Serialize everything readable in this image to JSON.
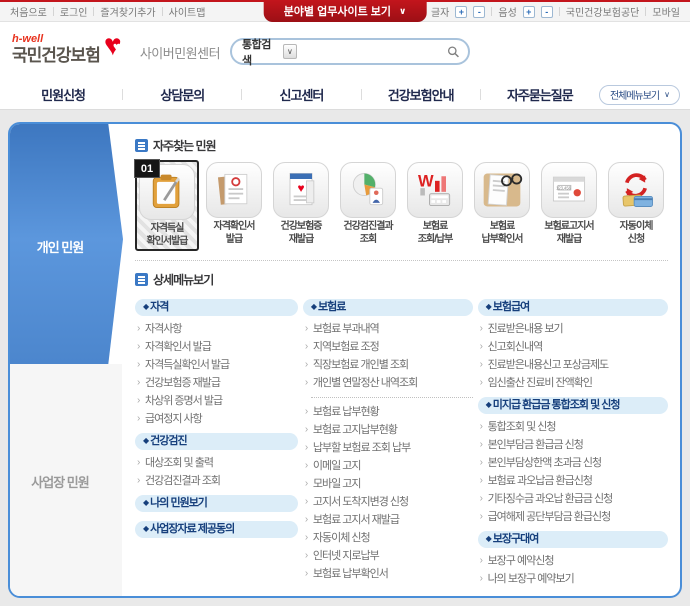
{
  "colors": {
    "brand_red": "#e8001c",
    "topbar_button_red": "#c3151c",
    "box_border_blue": "#4a8ed8",
    "sidebar_blue": "#4c86cd",
    "section_pill_bg": "#dcedf8",
    "section_text": "#163f7c"
  },
  "utility_bar": {
    "links_left": [
      "처음으로",
      "로그인",
      "즐겨찾기추가",
      "사이트맵"
    ],
    "center_button": "분야별 업무사이트 보기",
    "font_label": "글자",
    "voice_label": "음성",
    "plus": "+",
    "minus": "-",
    "links_right": [
      "국민건강보험공단",
      "모바일"
    ]
  },
  "header": {
    "logo_top": "h-well",
    "logo_main": "국민건강보험",
    "site_name": "사이버민원센터",
    "search": {
      "category": "통합검색",
      "value": "",
      "placeholder": ""
    }
  },
  "nav": {
    "items": [
      "민원신청",
      "상담문의",
      "신고센터",
      "건강보험안내",
      "자주묻는질문"
    ],
    "all_menu_label": "전체메뉴보기"
  },
  "sidebar": {
    "tabs": [
      {
        "label": "개인 민원",
        "active": true
      },
      {
        "label": "사업장 민원",
        "active": false
      }
    ]
  },
  "favorites": {
    "title": "자주찾는 민원",
    "items": [
      {
        "badge": "01",
        "selected": true,
        "icon": "clipboard-pen",
        "lines": [
          "자격득실",
          "확인서발급"
        ]
      },
      {
        "selected": false,
        "icon": "certificate-stamp",
        "lines": [
          "자격확인서",
          "발급"
        ]
      },
      {
        "selected": false,
        "icon": "health-card",
        "lines": [
          "건강보험증",
          "재발급"
        ]
      },
      {
        "selected": false,
        "icon": "pie-person",
        "lines": [
          "건강검진결과",
          "조회"
        ]
      },
      {
        "selected": false,
        "icon": "won-chart",
        "lines": [
          "보험료",
          "조회/납부"
        ]
      },
      {
        "selected": false,
        "icon": "receipt-glasses",
        "lines": [
          "보험료",
          "납부확인서"
        ]
      },
      {
        "selected": false,
        "icon": "bill-notice",
        "lines": [
          "보험료고지서",
          "재발급"
        ]
      },
      {
        "selected": false,
        "icon": "transfer-arrows",
        "lines": [
          "자동이체",
          "신청"
        ]
      }
    ]
  },
  "detail_menu": {
    "title": "상세메뉴보기",
    "columns": [
      {
        "sections": [
          {
            "header": "자격",
            "items": [
              "자격사항",
              "자격확인서 발급",
              "자격득실확인서 발급",
              "건강보험증 재발급",
              "차상위 증명서 발급",
              "급여정지 사항"
            ]
          },
          {
            "header": "건강검진",
            "items": [
              "대상조회 및 출력",
              "건강검진결과 조회"
            ]
          },
          {
            "header": "나의 민원보기",
            "items": []
          },
          {
            "header": "사업장자료 제공동의",
            "items": []
          }
        ]
      },
      {
        "sections": [
          {
            "header": "보험료",
            "items": [
              "보험료 부과내역",
              "지역보험료 조정",
              "직장보험료 개인별 조회",
              "개인별 연말정산 내역조회"
            ]
          },
          {
            "divider": true,
            "items": [
              "보험료 납부현황",
              "보험료 고지납부현황",
              "납부할 보험료 조회 납부",
              "이메일 고지",
              "모바일 고지",
              "고지서 도착지변경 신청",
              "보험료 고지서 재발급",
              "자동이체 신청",
              "인터넷 지로납부",
              "보험료 납부확인서"
            ]
          }
        ]
      },
      {
        "sections": [
          {
            "header": "보험급여",
            "items": [
              "진료받은내용 보기",
              "신고회신내역",
              "진료받은내용신고 포상금제도",
              "임신출산 진료비 잔액확인"
            ]
          },
          {
            "header": "미지급 환급금 통합조회 및 신청",
            "items": [
              "통합조회 및 신청",
              "본인부담금 환급금 신청",
              "본인부담상한액 초과금 신청",
              "보험료 과오납금 환급신청",
              "기타징수금 과오납 환급금 신청",
              "급여해제 공단부담금 환급신청"
            ]
          },
          {
            "header": "보장구대여",
            "items": [
              "보장구 예약신청",
              "나의 보장구 예약보기"
            ]
          }
        ]
      }
    ]
  }
}
